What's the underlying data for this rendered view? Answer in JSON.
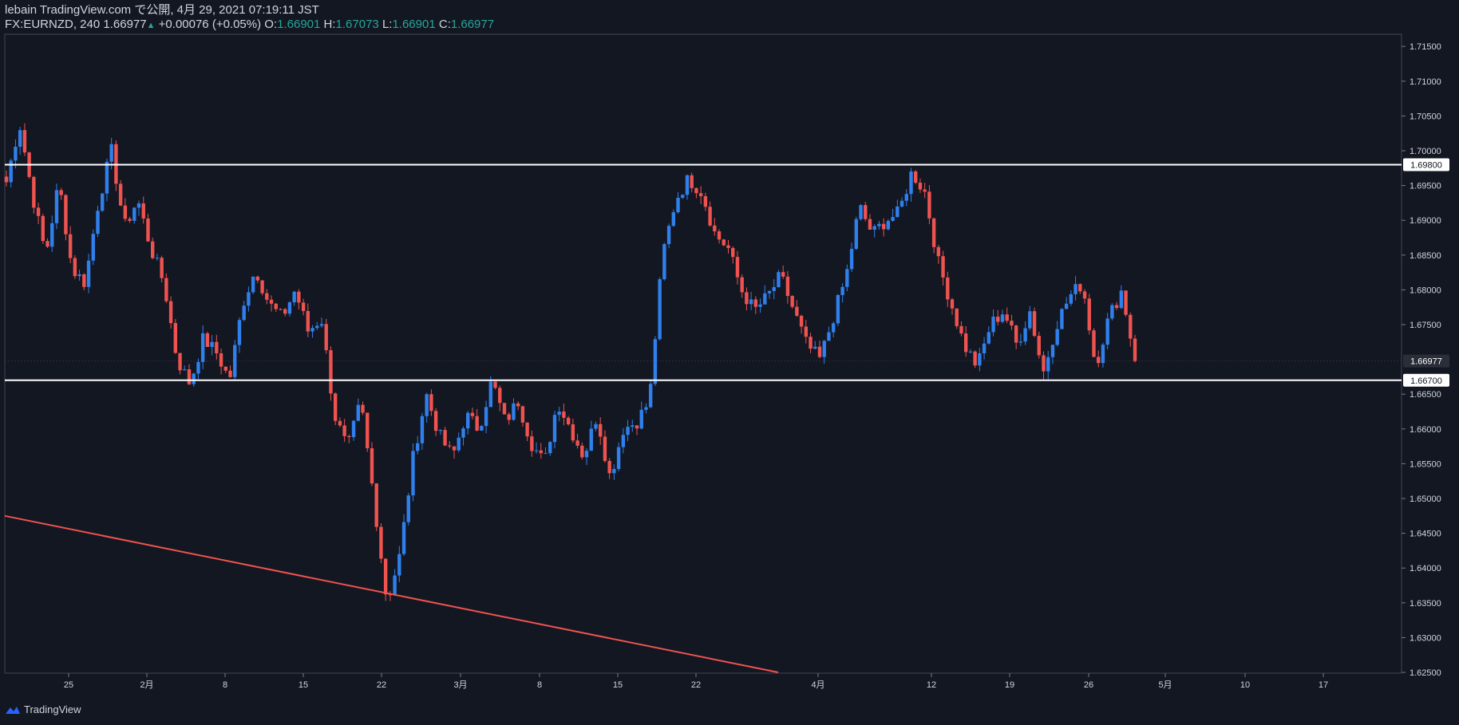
{
  "header": {
    "line1": "lebain TradingView.com で公開, 4月 29, 2021 07:19:11 JST",
    "symbol": "FX:EURNZD, 240",
    "last": "1.66977",
    "change": "+0.00076 (+0.05%)",
    "o_label": "O:",
    "o_value": "1.66901",
    "h_label": "H:",
    "h_value": "1.67073",
    "l_label": "L:",
    "l_value": "1.66901",
    "c_label": "C:",
    "c_value": "1.66977"
  },
  "footer": {
    "brand": "TradingView"
  },
  "colors": {
    "background": "#131722",
    "bull": "#2f80ed",
    "bear": "#ef5350",
    "hline": "#ffffff",
    "trendline": "#ef5350",
    "axis_text": "#d1d4dc"
  },
  "chart_data": {
    "type": "candlestick",
    "symbol": "FX:EURNZD",
    "timeframe": "240",
    "ylim": [
      1.625,
      1.7175
    ],
    "y_ticks": [
      "1.71500",
      "1.71000",
      "1.70500",
      "1.70000",
      "1.69500",
      "1.69000",
      "1.68500",
      "1.68000",
      "1.67500",
      "1.66500",
      "1.66000",
      "1.65500",
      "1.65000",
      "1.64500",
      "1.64000",
      "1.63500",
      "1.63000",
      "1.62500"
    ],
    "x_ticks": [
      "25",
      "2月",
      "8",
      "15",
      "22",
      "3月",
      "8",
      "15",
      "22",
      "4月",
      "12",
      "19",
      "26",
      "5月",
      "10",
      "17"
    ],
    "horizontal_lines": [
      {
        "value": 1.698,
        "label": "1.69800"
      },
      {
        "value": 1.667,
        "label": "1.66700"
      }
    ],
    "price_label": {
      "value": 1.66977,
      "label": "1.66977"
    },
    "trendline": {
      "from": {
        "date": "Jan 19",
        "price": 1.6475
      },
      "to": {
        "date": "Mar 31",
        "price": 1.625
      }
    },
    "series_anchors": [
      {
        "date": "Jan 18 (start)",
        "price": 1.6955
      },
      {
        "date": "Jan 19",
        "price": 1.704
      },
      {
        "date": "Jan 21",
        "price": 1.6935
      },
      {
        "date": "Jan 23",
        "price": 1.685
      },
      {
        "date": "Jan 25",
        "price": 1.6955
      },
      {
        "date": "Jan 27",
        "price": 1.683
      },
      {
        "date": "Jan 29",
        "price": 1.681
      },
      {
        "date": "Jan 31",
        "price": 1.6925
      },
      {
        "date": "Feb 1",
        "price": 1.7
      },
      {
        "date": "Feb 2",
        "price": 1.689
      },
      {
        "date": "Feb 3",
        "price": 1.693
      },
      {
        "date": "Feb 4",
        "price": 1.686
      },
      {
        "date": "Feb 6",
        "price": 1.681
      },
      {
        "date": "Feb 7",
        "price": 1.67
      },
      {
        "date": "Feb 8",
        "price": 1.6665
      },
      {
        "date": "Feb 9",
        "price": 1.673
      },
      {
        "date": "Feb 11",
        "price": 1.671
      },
      {
        "date": "Feb 12",
        "price": 1.667
      },
      {
        "date": "Feb 14",
        "price": 1.678
      },
      {
        "date": "Feb 15",
        "price": 1.683
      },
      {
        "date": "Feb 16",
        "price": 1.678
      },
      {
        "date": "Feb 17",
        "price": 1.676
      },
      {
        "date": "Feb 18",
        "price": 1.68
      },
      {
        "date": "Feb 19",
        "price": 1.674
      },
      {
        "date": "Feb 20",
        "price": 1.676
      },
      {
        "date": "Feb 22",
        "price": 1.662
      },
      {
        "date": "Feb 23",
        "price": 1.657
      },
      {
        "date": "Feb 24",
        "price": 1.664
      },
      {
        "date": "Feb 25",
        "price": 1.65
      },
      {
        "date": "Feb 26",
        "price": 1.635
      },
      {
        "date": "Feb 27",
        "price": 1.642
      },
      {
        "date": "Feb 28",
        "price": 1.656
      },
      {
        "date": "Mar 1",
        "price": 1.665
      },
      {
        "date": "Mar 2",
        "price": 1.659
      },
      {
        "date": "Mar 4",
        "price": 1.656
      },
      {
        "date": "Mar 5",
        "price": 1.662
      },
      {
        "date": "Mar 6",
        "price": 1.66
      },
      {
        "date": "Mar 7",
        "price": 1.667
      },
      {
        "date": "Mar 8",
        "price": 1.661
      },
      {
        "date": "Mar 9",
        "price": 1.664
      },
      {
        "date": "Mar 11",
        "price": 1.658
      },
      {
        "date": "Mar 12",
        "price": 1.655
      },
      {
        "date": "Mar 14",
        "price": 1.664
      },
      {
        "date": "Mar 15",
        "price": 1.66
      },
      {
        "date": "Mar 17",
        "price": 1.656
      },
      {
        "date": "Mar 18",
        "price": 1.662
      },
      {
        "date": "Mar 19",
        "price": 1.653
      },
      {
        "date": "Mar 20",
        "price": 1.66
      },
      {
        "date": "Mar 21",
        "price": 1.661
      },
      {
        "date": "Mar 22",
        "price": 1.664
      },
      {
        "date": "Mar 23",
        "price": 1.685
      },
      {
        "date": "Mar 24",
        "price": 1.693
      },
      {
        "date": "Mar 25",
        "price": 1.696
      },
      {
        "date": "Mar 26",
        "price": 1.694
      },
      {
        "date": "Mar 27",
        "price": 1.688
      },
      {
        "date": "Mar 29",
        "price": 1.686
      },
      {
        "date": "Mar 30",
        "price": 1.68
      },
      {
        "date": "Mar 31",
        "price": 1.677
      },
      {
        "date": "Apr 1",
        "price": 1.679
      },
      {
        "date": "Apr 2",
        "price": 1.682
      },
      {
        "date": "Apr 3",
        "price": 1.677
      },
      {
        "date": "Apr 5",
        "price": 1.672
      },
      {
        "date": "Apr 6",
        "price": 1.67
      },
      {
        "date": "Apr 7",
        "price": 1.676
      },
      {
        "date": "Apr 8",
        "price": 1.682
      },
      {
        "date": "Apr 9",
        "price": 1.692
      },
      {
        "date": "Apr 10",
        "price": 1.688
      },
      {
        "date": "Apr 11",
        "price": 1.69
      },
      {
        "date": "Apr 12",
        "price": 1.691
      },
      {
        "date": "Apr 13",
        "price": 1.697
      },
      {
        "date": "Apr 14",
        "price": 1.694
      },
      {
        "date": "Apr 15",
        "price": 1.684
      },
      {
        "date": "Apr 16",
        "price": 1.678
      },
      {
        "date": "Apr 17",
        "price": 1.672
      },
      {
        "date": "Apr 18",
        "price": 1.669
      },
      {
        "date": "Apr 19",
        "price": 1.675
      },
      {
        "date": "Apr 20",
        "price": 1.677
      },
      {
        "date": "Apr 21",
        "price": 1.672
      },
      {
        "date": "Apr 22",
        "price": 1.677
      },
      {
        "date": "Apr 23",
        "price": 1.668
      },
      {
        "date": "Apr 24",
        "price": 1.675
      },
      {
        "date": "Apr 25",
        "price": 1.679
      },
      {
        "date": "Apr 26",
        "price": 1.681
      },
      {
        "date": "Apr 27",
        "price": 1.669
      },
      {
        "date": "Apr 28",
        "price": 1.676
      },
      {
        "date": "Apr 28 (late)",
        "price": 1.68
      },
      {
        "date": "Apr 29",
        "price": 1.66977
      }
    ]
  }
}
